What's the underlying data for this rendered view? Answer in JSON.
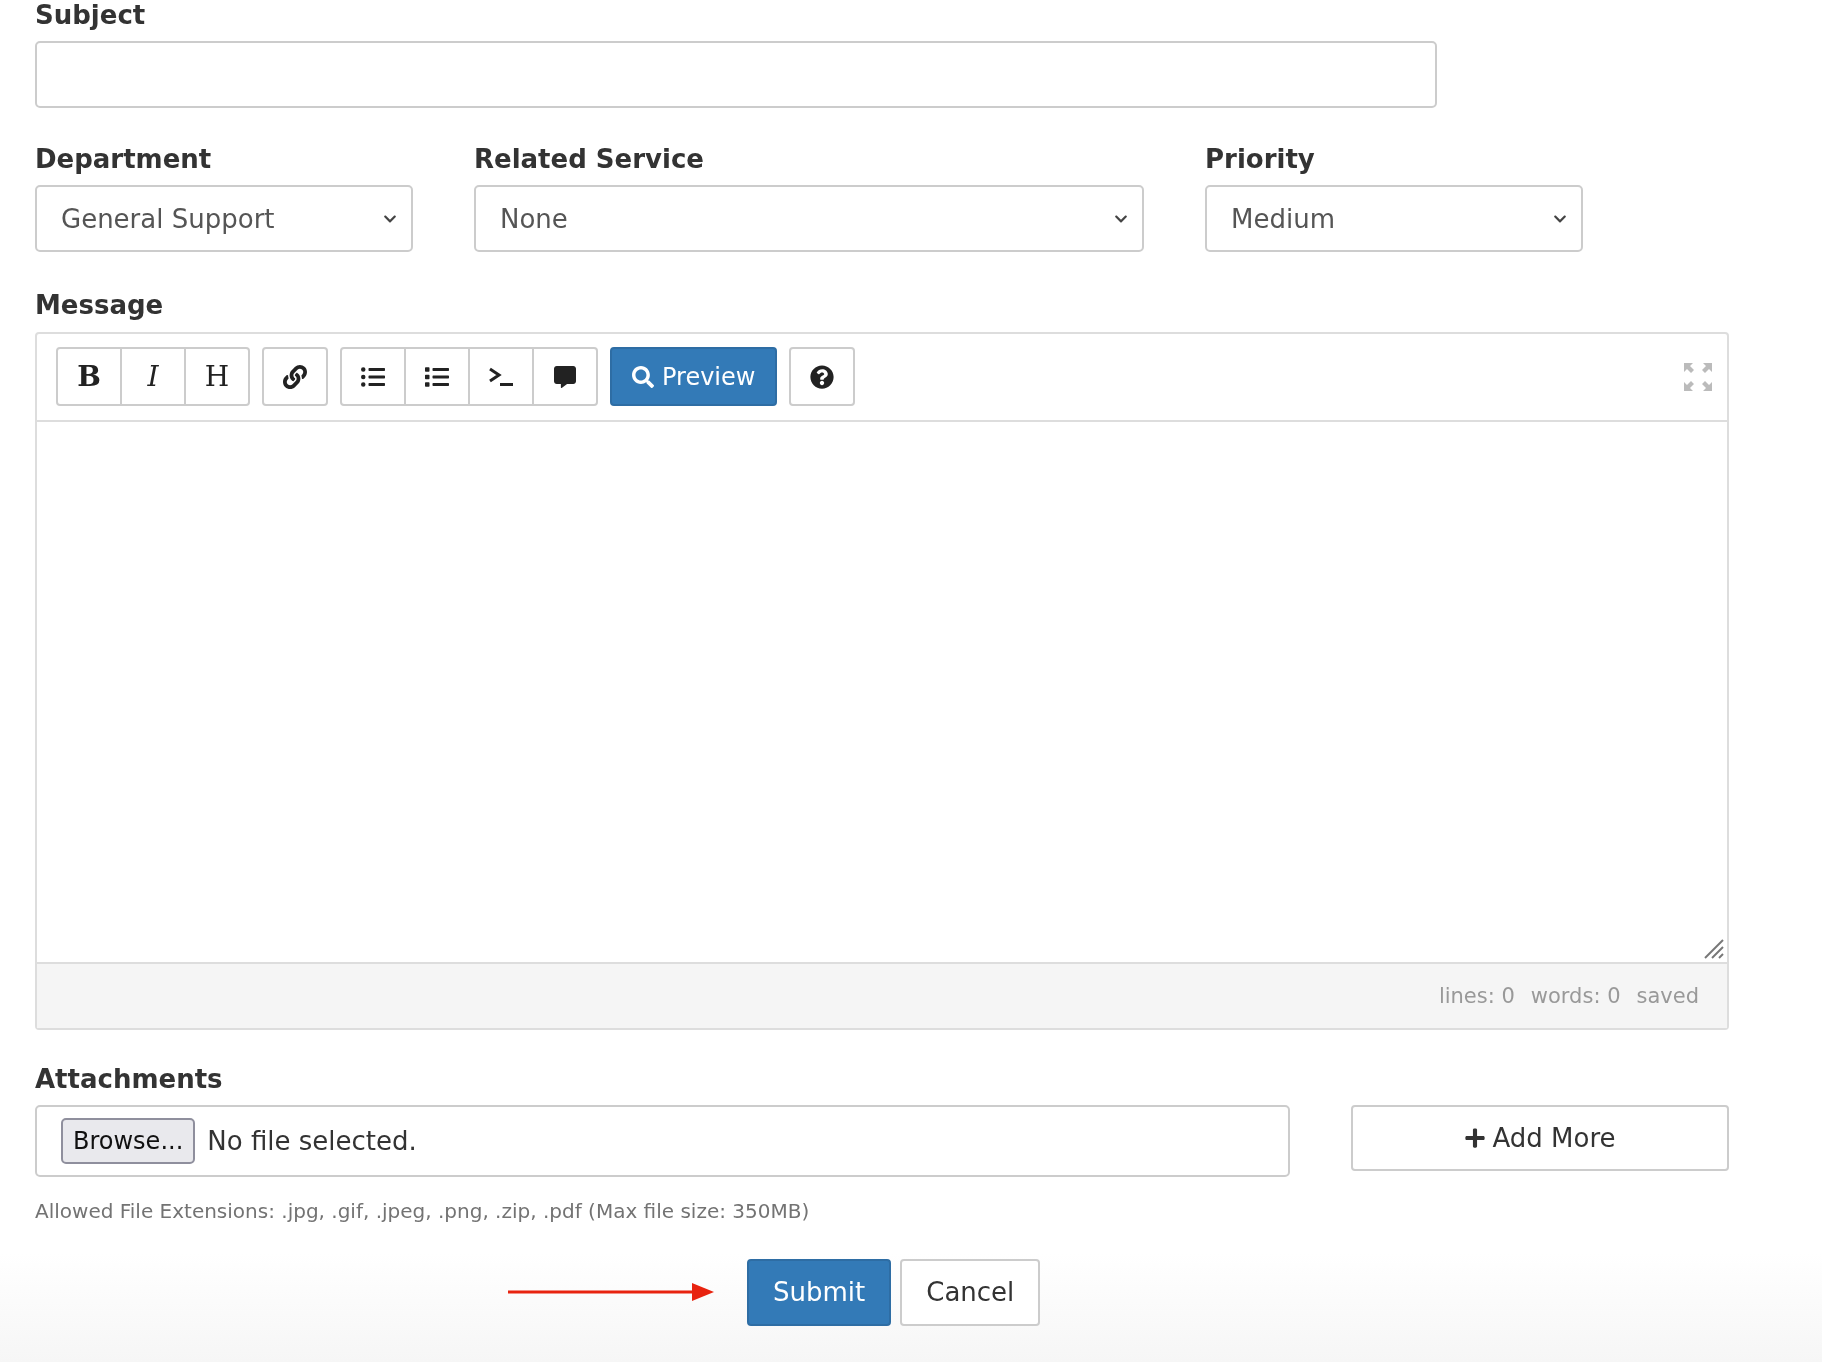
{
  "subject": {
    "label": "Subject"
  },
  "selects": [
    {
      "label": "Department",
      "value": "General Support"
    },
    {
      "label": "Related Service",
      "value": "None"
    },
    {
      "label": "Priority",
      "value": "Medium"
    }
  ],
  "message": {
    "label": "Message",
    "toolbar": [
      [
        {
          "kind": "bold",
          "label": "B"
        },
        {
          "kind": "italic",
          "label": "I"
        },
        {
          "kind": "heading",
          "label": "H"
        }
      ],
      [
        {
          "kind": "link"
        }
      ],
      [
        {
          "kind": "ordered-list"
        },
        {
          "kind": "unordered-list"
        },
        {
          "kind": "code"
        },
        {
          "kind": "quote"
        }
      ],
      [
        {
          "kind": "preview",
          "label": "Preview"
        }
      ],
      [
        {
          "kind": "help"
        }
      ]
    ],
    "status": [
      "lines: 0",
      "words: 0",
      "saved"
    ]
  },
  "attachments": {
    "label": "Attachments",
    "browse": "Browse...",
    "file_status": "No file selected.",
    "add_more": "Add More",
    "help": "Allowed File Extensions: .jpg, .gif, .jpeg, .png, .zip, .pdf (Max file size: 350MB)"
  },
  "actions": {
    "submit": "Submit",
    "cancel": "Cancel"
  }
}
